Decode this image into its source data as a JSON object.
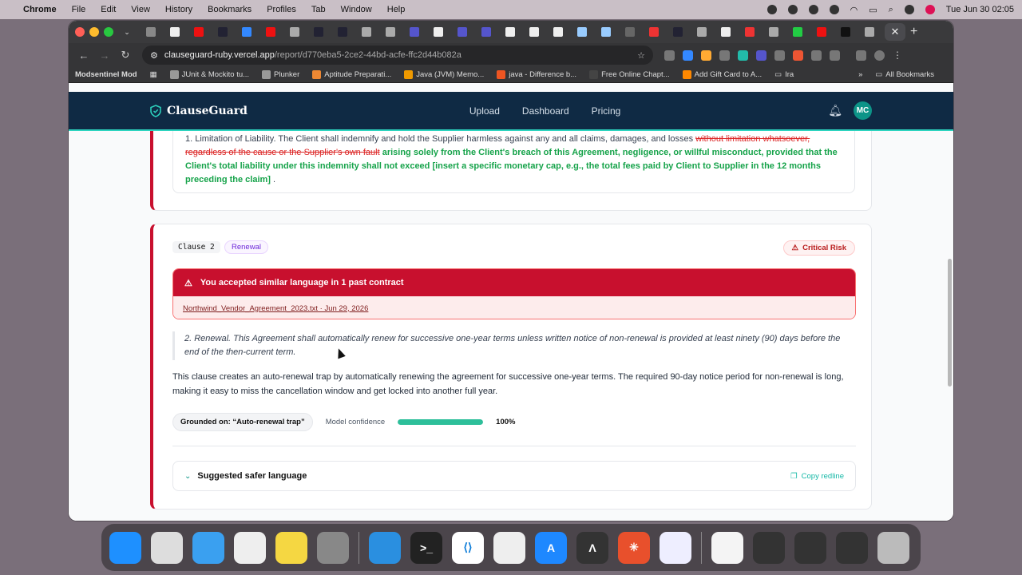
{
  "menubar": {
    "apple": "",
    "app": "Chrome",
    "items": [
      "File",
      "Edit",
      "View",
      "History",
      "Bookmarks",
      "Profiles",
      "Tab",
      "Window",
      "Help"
    ],
    "clock": "Tue Jun 30  02:05"
  },
  "browser": {
    "url_host": "clauseguard-ruby.vercel.app",
    "url_path": "/report/d770eba5-2ce2-44bd-acfe-ffc2d44b082a",
    "close_tab": "✕",
    "new_tab": "+"
  },
  "bookmarks": [
    "Modsentinel Mod",
    "JUnit & Mockito tu...",
    "Plunker",
    "Aptitude Preparati...",
    "Java (JVM) Memo...",
    "java - Difference b...",
    "Free Online Chapt...",
    "Add Gift Card to A...",
    "Ira",
    "All Bookmarks"
  ],
  "app": {
    "brand": "ClauseGuard",
    "nav": [
      "Upload",
      "Dashboard",
      "Pricing"
    ],
    "avatar": "MC"
  },
  "clause1": {
    "plain": "1. Limitation of Liability. The Client shall indemnify and hold the Supplier harmless against any and all claims, damages, and losses ",
    "deleted": "without limitation whatsoever, regardless of the cause or the Supplier's own fault",
    "inserted": "arising solely from the Client's breach of this Agreement, negligence, or willful misconduct, provided that the Client's total liability under this indemnity shall not exceed [insert a specific monetary cap, e.g., the total fees paid by Client to Supplier in the 12 months preceding the claim]",
    "end": " ."
  },
  "clause2": {
    "number": "Clause 2",
    "category": "Renewal",
    "risk": "Critical Risk",
    "alert_title": "You accepted similar language in 1 past contract",
    "alert_link": "Northwind_Vendor_Agreement_2023.txt · Jun 29, 2026",
    "quote": "2. Renewal. This Agreement shall automatically renew for successive one-year terms unless written notice of non-renewal is provided at least ninety (90) days before the end of the then-current term.",
    "explanation": "This clause creates an auto-renewal trap by automatically renewing the agreement for successive one-year terms. The required 90-day notice period for non-renewal is long, making it easy to miss the cancellation window and get locked into another full year.",
    "grounded": "Grounded on: “Auto-renewal trap”",
    "confidence_label": "Model confidence",
    "confidence_value": "100%",
    "confidence_fraction": 1.0,
    "suggest": "Suggested safer language",
    "copy": "Copy redline"
  },
  "colors": {
    "accent": "#c8102e",
    "teal": "#2dd4bf",
    "nav_bg": "#0f2a44"
  }
}
